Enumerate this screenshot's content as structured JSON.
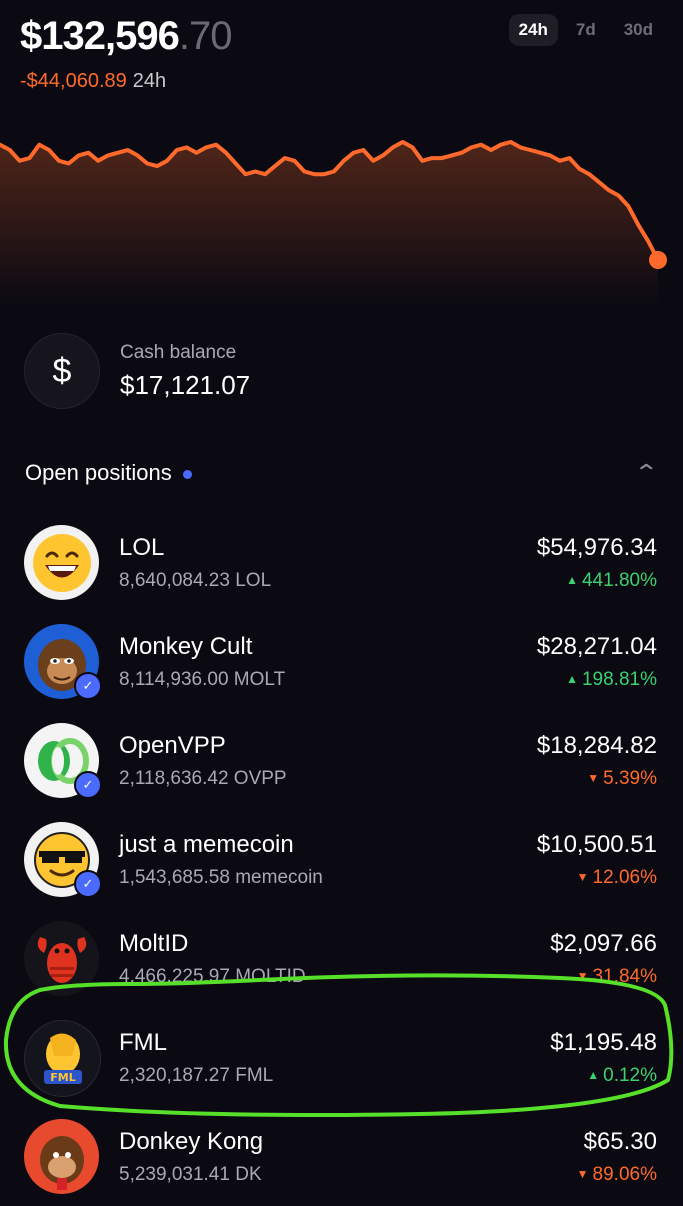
{
  "header": {
    "balance_main": "$132,596",
    "balance_cents": ".70",
    "change_amount": "-$44,060.89",
    "change_period": "24h",
    "ranges": [
      "24h",
      "7d",
      "30d"
    ],
    "active_range": "24h"
  },
  "cash": {
    "symbol": "$",
    "label": "Cash balance",
    "value": "$17,121.07"
  },
  "positions": {
    "title": "Open positions",
    "items": [
      {
        "name": "LOL",
        "quantity": "8,640,084.23 LOL",
        "value": "$54,976.34",
        "change": "441.80%",
        "direction": "up",
        "icon": "laughing-emoji-icon",
        "verified": false
      },
      {
        "name": "Monkey Cult",
        "quantity": "8,114,936.00 MOLT",
        "value": "$28,271.04",
        "change": "198.81%",
        "direction": "up",
        "icon": "monkey-avatar-icon",
        "verified": true
      },
      {
        "name": "OpenVPP",
        "quantity": "2,118,636.42 OVPP",
        "value": "$18,284.82",
        "change": "5.39%",
        "direction": "down",
        "icon": "openvpp-logo-icon",
        "verified": true
      },
      {
        "name": "just a memecoin",
        "quantity": "1,543,685.58 memecoin",
        "value": "$10,500.51",
        "change": "12.06%",
        "direction": "down",
        "icon": "sunglasses-emoji-icon",
        "verified": true
      },
      {
        "name": "MoltID",
        "quantity": "4,466,225.97 MOLTID",
        "value": "$2,097.66",
        "change": "31.84%",
        "direction": "down",
        "icon": "lobster-icon",
        "verified": false
      },
      {
        "name": "FML",
        "quantity": "2,320,187.27 FML",
        "value": "$1,195.48",
        "change": "0.12%",
        "direction": "up",
        "icon": "facepalm-icon",
        "verified": false,
        "badge": "FML"
      },
      {
        "name": "Donkey Kong",
        "quantity": "5,239,031.41 DK",
        "value": "$65.30",
        "change": "89.06%",
        "direction": "down",
        "icon": "donkey-kong-icon",
        "verified": false
      }
    ]
  },
  "chart_data": {
    "type": "line",
    "period": "24h",
    "values": [
      98,
      96,
      92,
      93,
      98,
      96,
      92,
      91,
      94,
      95,
      92,
      94,
      95,
      96,
      94,
      91,
      90,
      92,
      96,
      97,
      95,
      97,
      98,
      95,
      91,
      87,
      88,
      87,
      90,
      93,
      92,
      88,
      87,
      87,
      88,
      92,
      95,
      96,
      92,
      94,
      97,
      99,
      97,
      92,
      93,
      93,
      94,
      95,
      97,
      98,
      96,
      98,
      99,
      97,
      96,
      95,
      94,
      92,
      93,
      89,
      87,
      84,
      81,
      79,
      75,
      68,
      62,
      55
    ],
    "colors": {
      "line": "#ff6a2c",
      "up": "#3bd16f",
      "down": "#ff6a2c",
      "accent": "#4b6bff",
      "highlight": "#57e02a"
    }
  }
}
